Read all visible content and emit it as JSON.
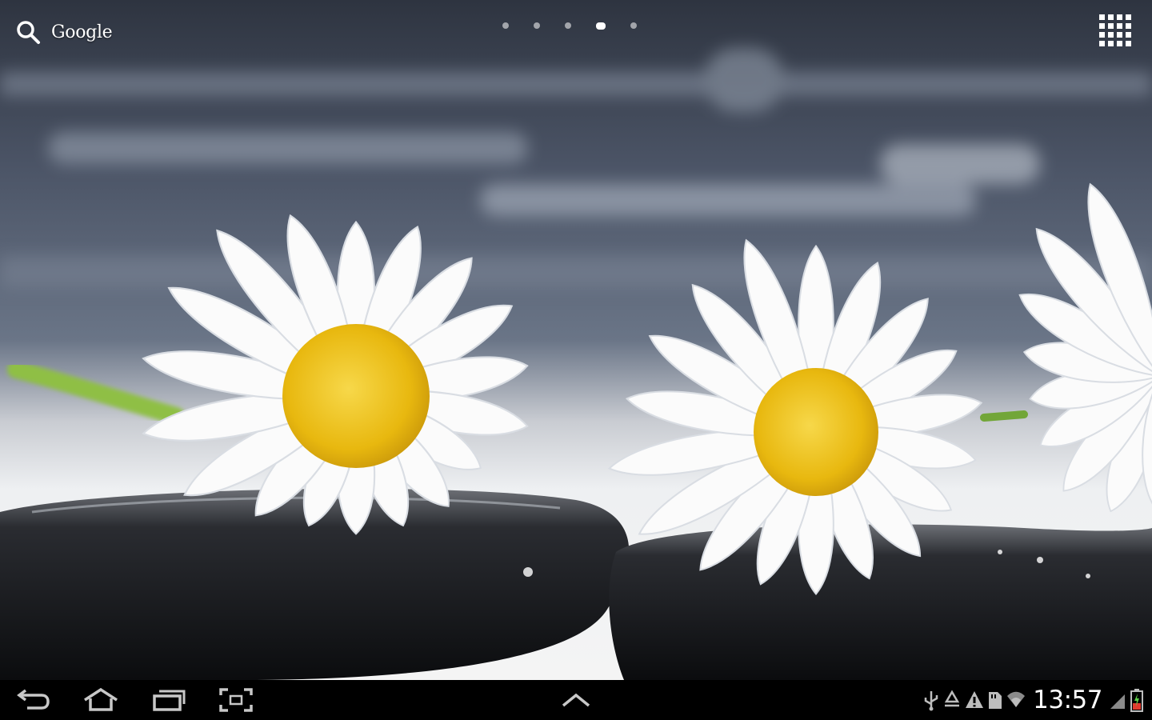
{
  "wallpaper": {
    "description": "",
    "colors": {
      "sky": "#4a5566",
      "petal": "#ffffff",
      "center": "#f2c91a",
      "stone": "#1a1b1f"
    }
  },
  "search": {
    "label": "Google",
    "icon": "search-icon"
  },
  "pager": {
    "count": 5,
    "active_index": 3
  },
  "apps_button": {
    "icon": "apps-grid-icon"
  },
  "navbar": {
    "buttons": [
      {
        "name": "back",
        "icon": "back-icon"
      },
      {
        "name": "home",
        "icon": "home-icon"
      },
      {
        "name": "recent-apps",
        "icon": "recent-apps-icon"
      },
      {
        "name": "screenshot",
        "icon": "screenshot-icon"
      }
    ],
    "center_icon": "chevron-up-icon"
  },
  "status": {
    "time": "13:57",
    "icons": [
      "usb-icon",
      "recycle-icon",
      "warning-icon",
      "sd-card-icon",
      "wifi-icon",
      "signal-icon",
      "battery-icon"
    ]
  }
}
